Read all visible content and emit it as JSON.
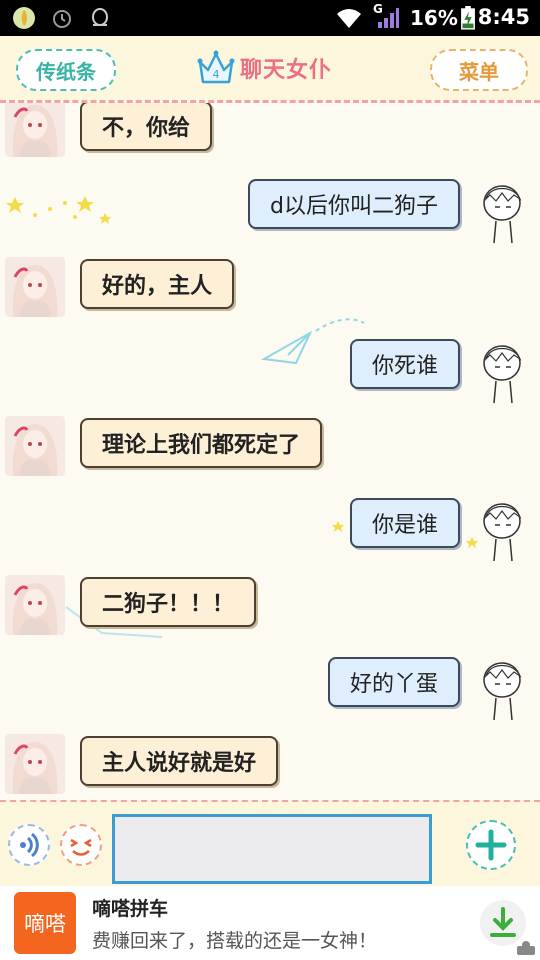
{
  "status_bar": {
    "battery_percent": "16%",
    "time": "8:45",
    "network_label": "G",
    "icons": [
      "app-icon",
      "notification-icon",
      "qq-icon",
      "wifi-icon",
      "signal-icon",
      "battery-charging-icon"
    ]
  },
  "header": {
    "left_button": "传纸条",
    "title": "聊天女仆",
    "level": "4",
    "right_button": "菜单"
  },
  "messages": [
    {
      "side": "left",
      "text": "不，你给"
    },
    {
      "side": "right",
      "text": "d以后你叫二狗子"
    },
    {
      "side": "left",
      "text": "好的，主人"
    },
    {
      "side": "right",
      "text": "你死谁"
    },
    {
      "side": "left",
      "text": "理论上我们都死定了"
    },
    {
      "side": "right",
      "text": "你是谁"
    },
    {
      "side": "left",
      "text": "二狗子！！！"
    },
    {
      "side": "right",
      "text": "好的丫蛋"
    },
    {
      "side": "left",
      "text": "主人说好就是好"
    }
  ],
  "input": {
    "value": "",
    "placeholder": "",
    "icons": [
      "voice-icon",
      "emoji-icon",
      "add-icon"
    ]
  },
  "ad": {
    "logo_text": "嘀嗒",
    "title": "嘀嗒拼车",
    "description": "费赚回来了，搭载的还是一女神！",
    "icons": [
      "download-icon"
    ]
  },
  "colors": {
    "accent_teal": "#39b3a6",
    "accent_orange": "#e49a3a",
    "title_pink": "#ec6f84",
    "ad_orange": "#f4651f",
    "input_border": "#3a9bd5"
  }
}
